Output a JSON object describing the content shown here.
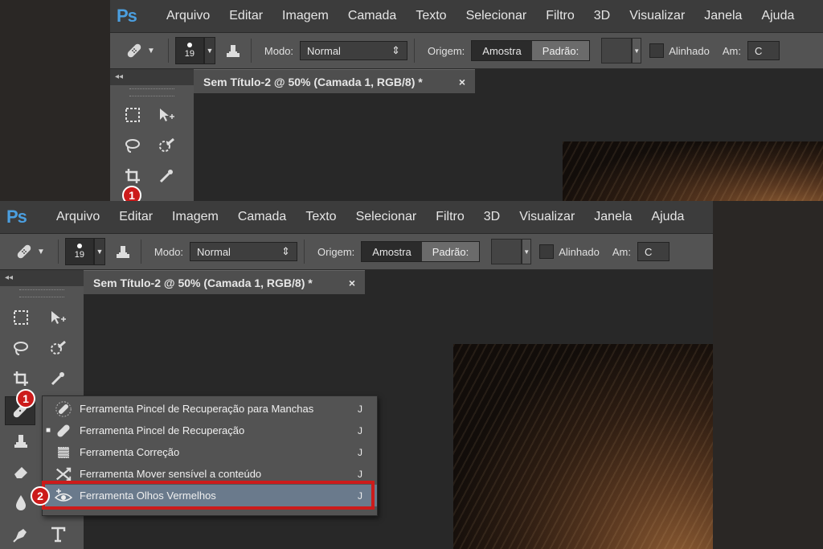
{
  "app": {
    "logo": "Ps"
  },
  "menu": [
    "Arquivo",
    "Editar",
    "Imagem",
    "Camada",
    "Texto",
    "Selecionar",
    "Filtro",
    "3D",
    "Visualizar",
    "Janela",
    "Ajuda"
  ],
  "options": {
    "brush_size": "19",
    "modo_label": "Modo:",
    "modo_value": "Normal",
    "origem_label": "Origem:",
    "origem_amostra": "Amostra",
    "origem_padrao": "Padrão:",
    "alinhado_label": "Alinhado",
    "am_label": "Am:",
    "am_value": "C"
  },
  "panel": {
    "collapse": "◂◂"
  },
  "document": {
    "tab_title": "Sem Título-2 @ 50% (Camada 1, RGB/8) *",
    "close": "×"
  },
  "flyout": {
    "items": [
      {
        "label": "Ferramenta Pincel de Recuperação para Manchas",
        "key": "J",
        "mark": ""
      },
      {
        "label": "Ferramenta Pincel de Recuperação",
        "key": "J",
        "mark": "■"
      },
      {
        "label": "Ferramenta Correção",
        "key": "J",
        "mark": ""
      },
      {
        "label": "Ferramenta Mover sensível a conteúdo",
        "key": "J",
        "mark": ""
      },
      {
        "label": "Ferramenta Olhos Vermelhos",
        "key": "J",
        "mark": ""
      }
    ]
  },
  "steps": {
    "one": "1",
    "two": "2"
  },
  "colors": {
    "accent_red": "#cc1b1b",
    "highlight": "#6a7a8c",
    "ps_blue": "#4b9fe0"
  }
}
